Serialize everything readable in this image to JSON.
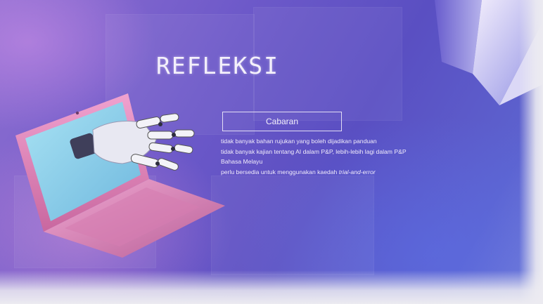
{
  "slide": {
    "title": "REFLEKSI",
    "section_heading": "Cabaran",
    "lines": [
      "tidak banyak bahan rujukan yang boleh dijadikan panduan",
      "tidak banyak kajian tentang AI dalam P&P, lebih-lebih lagi dalam P&P",
      "Bahasa Melayu"
    ],
    "last_line_prefix": "perlu bersedia untuk menggunakan kaedah ",
    "last_line_italic": "trial-and-error"
  },
  "colors": {
    "background_start": "#8f6fd1",
    "background_end": "#5a4fc2",
    "laptop_pink": "#e58cc4",
    "laptop_screen": "#8fd0ea",
    "text": "#f4f0fb"
  },
  "icons": [
    "laptop-icon",
    "robot-hand-icon",
    "crystal-prism-icon"
  ]
}
